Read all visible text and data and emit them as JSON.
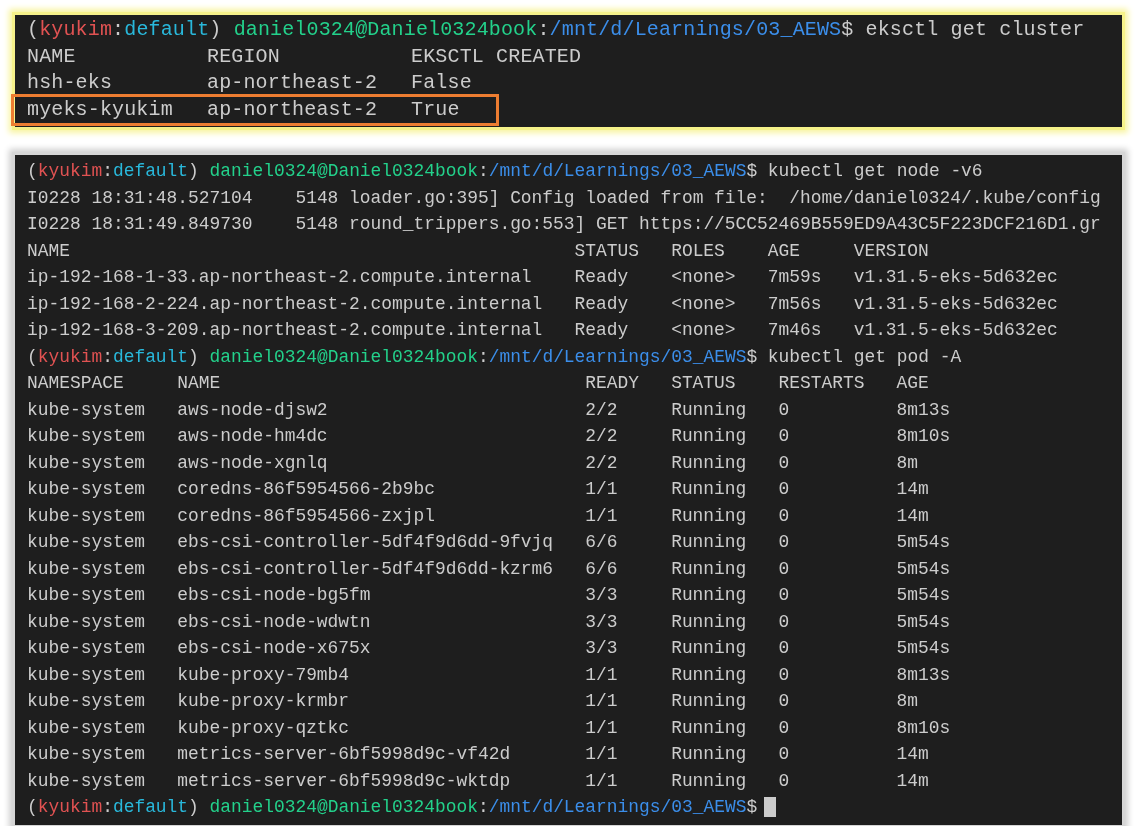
{
  "cluster_panel": {
    "blocks": [
      {
        "kind": "prompt",
        "cursor": false,
        "segments": [
          {
            "text": "(",
            "kind": "plain"
          },
          {
            "text": "kyukim",
            "kind": "context"
          },
          {
            "text": ":",
            "kind": "plain"
          },
          {
            "text": "default",
            "kind": "namespace"
          },
          {
            "text": ") ",
            "kind": "plain"
          },
          {
            "text": "daniel0324@Daniel0324book",
            "kind": "user"
          },
          {
            "text": ":",
            "kind": "plain"
          },
          {
            "text": "/mnt/d/Learnings/03_AEWS",
            "kind": "path"
          },
          {
            "text": "$ eksctl get cluster",
            "kind": "plain"
          }
        ]
      },
      {
        "kind": "table",
        "columns": [
          "NAME",
          "REGION",
          "EKSCTL CREATED"
        ],
        "rows": [
          {
            "highlighted": false,
            "cells": [
              "hsh-eks",
              "ap-northeast-2",
              "False"
            ]
          },
          {
            "highlighted": true,
            "cells": [
              "myeks-kyukim",
              "ap-northeast-2",
              "True"
            ]
          }
        ]
      }
    ]
  },
  "terminal_panel": {
    "blocks": [
      {
        "kind": "prompt",
        "cursor": false,
        "segments": [
          {
            "text": "(",
            "kind": "plain"
          },
          {
            "text": "kyukim",
            "kind": "context"
          },
          {
            "text": ":",
            "kind": "plain"
          },
          {
            "text": "default",
            "kind": "namespace"
          },
          {
            "text": ") ",
            "kind": "plain"
          },
          {
            "text": "daniel0324@Daniel0324book",
            "kind": "user"
          },
          {
            "text": ":",
            "kind": "plain"
          },
          {
            "text": "/mnt/d/Learnings/03_AEWS",
            "kind": "path"
          },
          {
            "text": "$ kubectl get node -v6",
            "kind": "plain"
          }
        ]
      },
      {
        "kind": "log",
        "text": "I0228 18:31:48.527104    5148 loader.go:395] Config loaded from file:  /home/daniel0324/.kube/config"
      },
      {
        "kind": "log",
        "text": "I0228 18:31:49.849730    5148 round_trippers.go:553] GET https://5CC52469B559ED9A43C5F223DCF216D1.gr"
      },
      {
        "kind": "table",
        "columns": [
          "NAME",
          "STATUS",
          "ROLES",
          "AGE",
          "VERSION"
        ],
        "rows": [
          {
            "highlighted": false,
            "cells": [
              "ip-192-168-1-33.ap-northeast-2.compute.internal",
              "Ready",
              "<none>",
              "7m59s",
              "v1.31.5-eks-5d632ec"
            ]
          },
          {
            "highlighted": false,
            "cells": [
              "ip-192-168-2-224.ap-northeast-2.compute.internal",
              "Ready",
              "<none>",
              "7m56s",
              "v1.31.5-eks-5d632ec"
            ]
          },
          {
            "highlighted": false,
            "cells": [
              "ip-192-168-3-209.ap-northeast-2.compute.internal",
              "Ready",
              "<none>",
              "7m46s",
              "v1.31.5-eks-5d632ec"
            ]
          }
        ]
      },
      {
        "kind": "prompt",
        "cursor": false,
        "segments": [
          {
            "text": "(",
            "kind": "plain"
          },
          {
            "text": "kyukim",
            "kind": "context"
          },
          {
            "text": ":",
            "kind": "plain"
          },
          {
            "text": "default",
            "kind": "namespace"
          },
          {
            "text": ") ",
            "kind": "plain"
          },
          {
            "text": "daniel0324@Daniel0324book",
            "kind": "user"
          },
          {
            "text": ":",
            "kind": "plain"
          },
          {
            "text": "/mnt/d/Learnings/03_AEWS",
            "kind": "path"
          },
          {
            "text": "$ kubectl get pod -A",
            "kind": "plain"
          }
        ]
      },
      {
        "kind": "table",
        "columns": [
          "NAMESPACE",
          "NAME",
          "READY",
          "STATUS",
          "RESTARTS",
          "AGE"
        ],
        "rows": [
          {
            "highlighted": false,
            "cells": [
              "kube-system",
              "aws-node-djsw2",
              "2/2",
              "Running",
              "0",
              "8m13s"
            ]
          },
          {
            "highlighted": false,
            "cells": [
              "kube-system",
              "aws-node-hm4dc",
              "2/2",
              "Running",
              "0",
              "8m10s"
            ]
          },
          {
            "highlighted": false,
            "cells": [
              "kube-system",
              "aws-node-xgnlq",
              "2/2",
              "Running",
              "0",
              "8m"
            ]
          },
          {
            "highlighted": false,
            "cells": [
              "kube-system",
              "coredns-86f5954566-2b9bc",
              "1/1",
              "Running",
              "0",
              "14m"
            ]
          },
          {
            "highlighted": false,
            "cells": [
              "kube-system",
              "coredns-86f5954566-zxjpl",
              "1/1",
              "Running",
              "0",
              "14m"
            ]
          },
          {
            "highlighted": false,
            "cells": [
              "kube-system",
              "ebs-csi-controller-5df4f9d6dd-9fvjq",
              "6/6",
              "Running",
              "0",
              "5m54s"
            ]
          },
          {
            "highlighted": false,
            "cells": [
              "kube-system",
              "ebs-csi-controller-5df4f9d6dd-kzrm6",
              "6/6",
              "Running",
              "0",
              "5m54s"
            ]
          },
          {
            "highlighted": false,
            "cells": [
              "kube-system",
              "ebs-csi-node-bg5fm",
              "3/3",
              "Running",
              "0",
              "5m54s"
            ]
          },
          {
            "highlighted": false,
            "cells": [
              "kube-system",
              "ebs-csi-node-wdwtn",
              "3/3",
              "Running",
              "0",
              "5m54s"
            ]
          },
          {
            "highlighted": false,
            "cells": [
              "kube-system",
              "ebs-csi-node-x675x",
              "3/3",
              "Running",
              "0",
              "5m54s"
            ]
          },
          {
            "highlighted": false,
            "cells": [
              "kube-system",
              "kube-proxy-79mb4",
              "1/1",
              "Running",
              "0",
              "8m13s"
            ]
          },
          {
            "highlighted": false,
            "cells": [
              "kube-system",
              "kube-proxy-krmbr",
              "1/1",
              "Running",
              "0",
              "8m"
            ]
          },
          {
            "highlighted": false,
            "cells": [
              "kube-system",
              "kube-proxy-qztkc",
              "1/1",
              "Running",
              "0",
              "8m10s"
            ]
          },
          {
            "highlighted": false,
            "cells": [
              "kube-system",
              "metrics-server-6bf5998d9c-vf42d",
              "1/1",
              "Running",
              "0",
              "14m"
            ]
          },
          {
            "highlighted": false,
            "cells": [
              "kube-system",
              "metrics-server-6bf5998d9c-wktdp",
              "1/1",
              "Running",
              "0",
              "14m"
            ]
          }
        ]
      },
      {
        "kind": "prompt",
        "cursor": true,
        "segments": [
          {
            "text": "(",
            "kind": "plain"
          },
          {
            "text": "kyukim",
            "kind": "context"
          },
          {
            "text": ":",
            "kind": "plain"
          },
          {
            "text": "default",
            "kind": "namespace"
          },
          {
            "text": ") ",
            "kind": "plain"
          },
          {
            "text": "daniel0324@Daniel0324book",
            "kind": "user"
          },
          {
            "text": ":",
            "kind": "plain"
          },
          {
            "text": "/mnt/d/Learnings/03_AEWS",
            "kind": "path"
          },
          {
            "text": "$",
            "kind": "plain"
          }
        ]
      }
    ]
  }
}
